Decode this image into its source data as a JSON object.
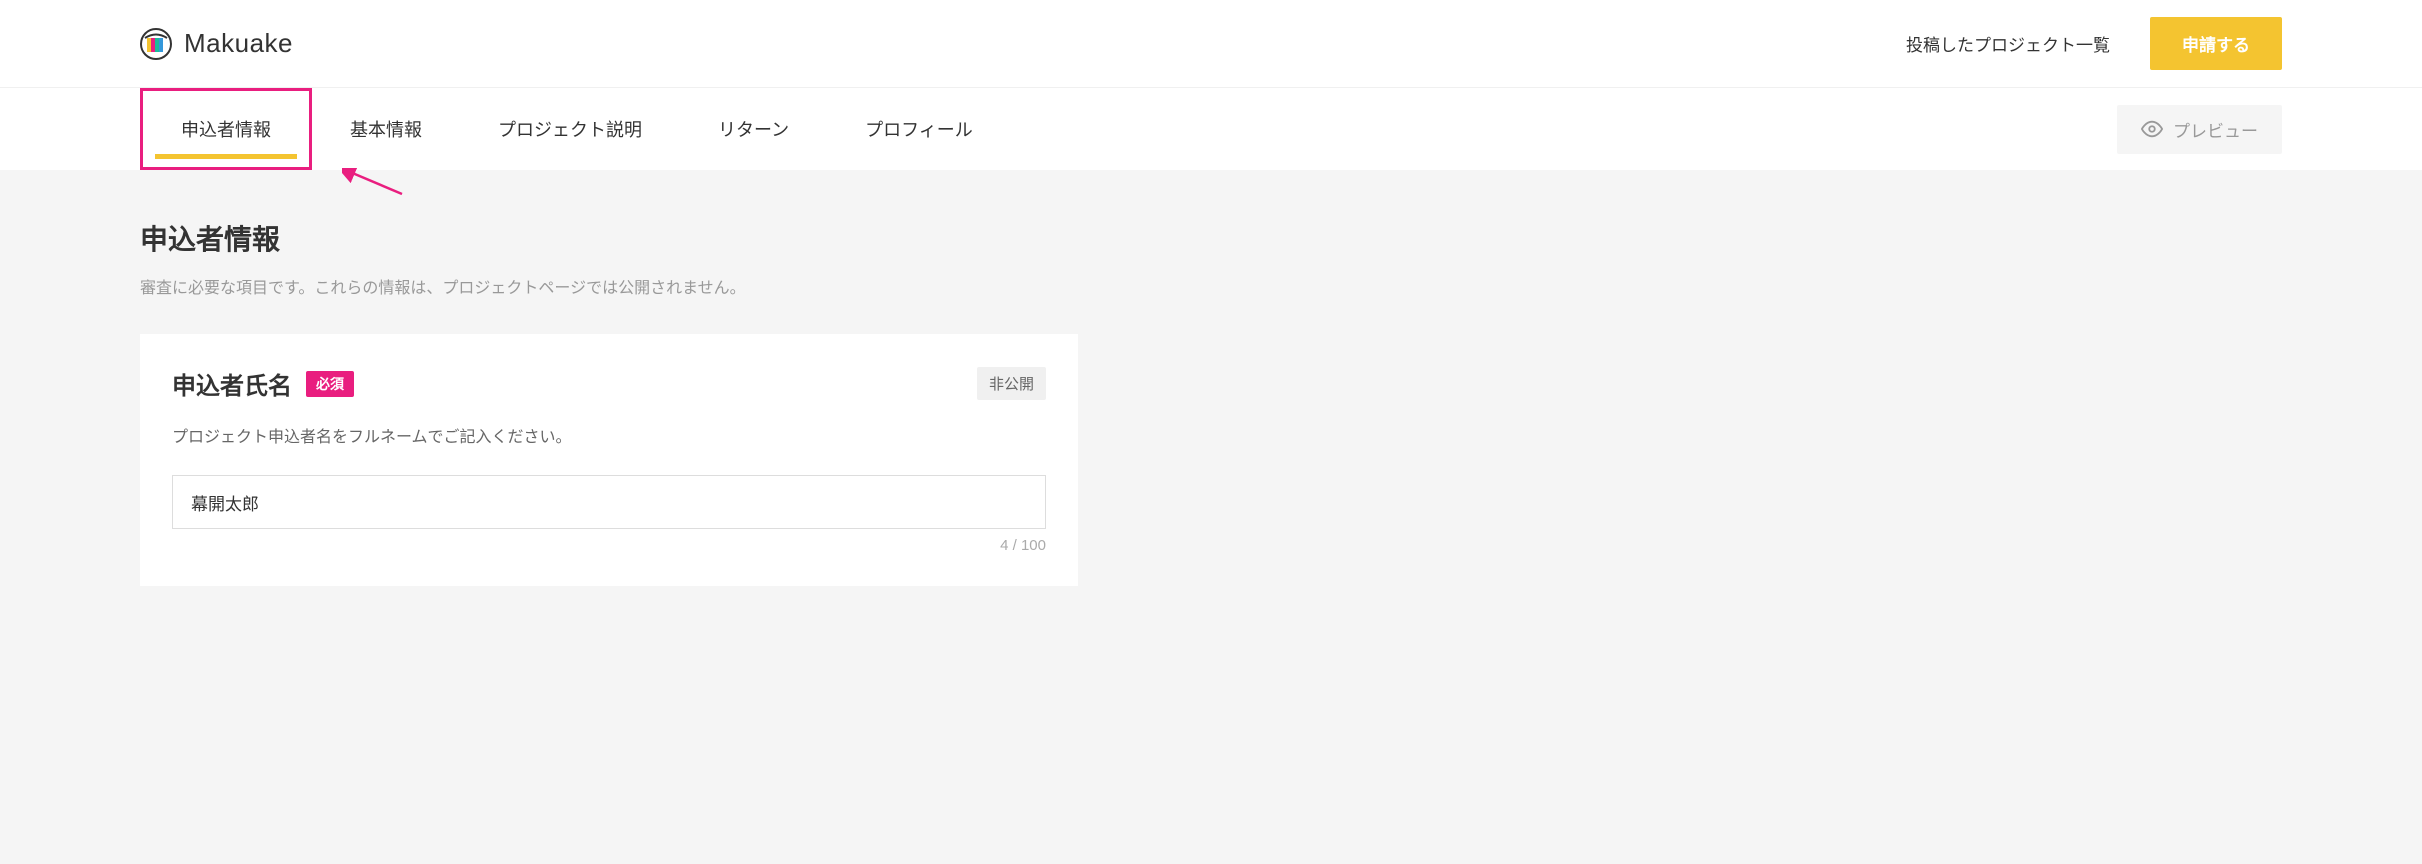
{
  "header": {
    "logo_text": "Makuake",
    "project_list_link": "投稿したプロジェクト一覧",
    "apply_button": "申請する"
  },
  "tabs": {
    "items": [
      {
        "label": "申込者情報",
        "active": true
      },
      {
        "label": "基本情報",
        "active": false
      },
      {
        "label": "プロジェクト説明",
        "active": false
      },
      {
        "label": "リターン",
        "active": false
      },
      {
        "label": "プロフィール",
        "active": false
      }
    ],
    "preview_button": "プレビュー"
  },
  "page": {
    "title": "申込者情報",
    "subtitle": "審査に必要な項目です。これらの情報は、プロジェクトページでは公開されません。"
  },
  "form": {
    "name_field": {
      "label": "申込者氏名",
      "required_badge": "必須",
      "privacy_badge": "非公開",
      "description": "プロジェクト申込者名をフルネームでご記入ください。",
      "value": "幕開太郎",
      "char_count": "4 / 100"
    }
  }
}
